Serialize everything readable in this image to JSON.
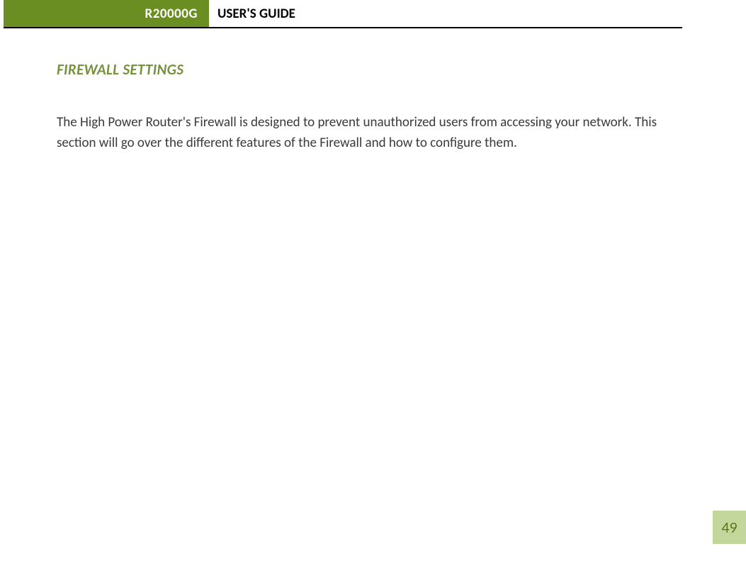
{
  "header": {
    "model": "R20000G",
    "title": "USER'S GUIDE"
  },
  "section": {
    "heading": "FIREWALL SETTINGS",
    "body": "The High Power Router's Firewall is designed to prevent unauthorized users from accessing your network.  This section will go over the different features of the Firewall and how to configure them."
  },
  "page_number": "49"
}
